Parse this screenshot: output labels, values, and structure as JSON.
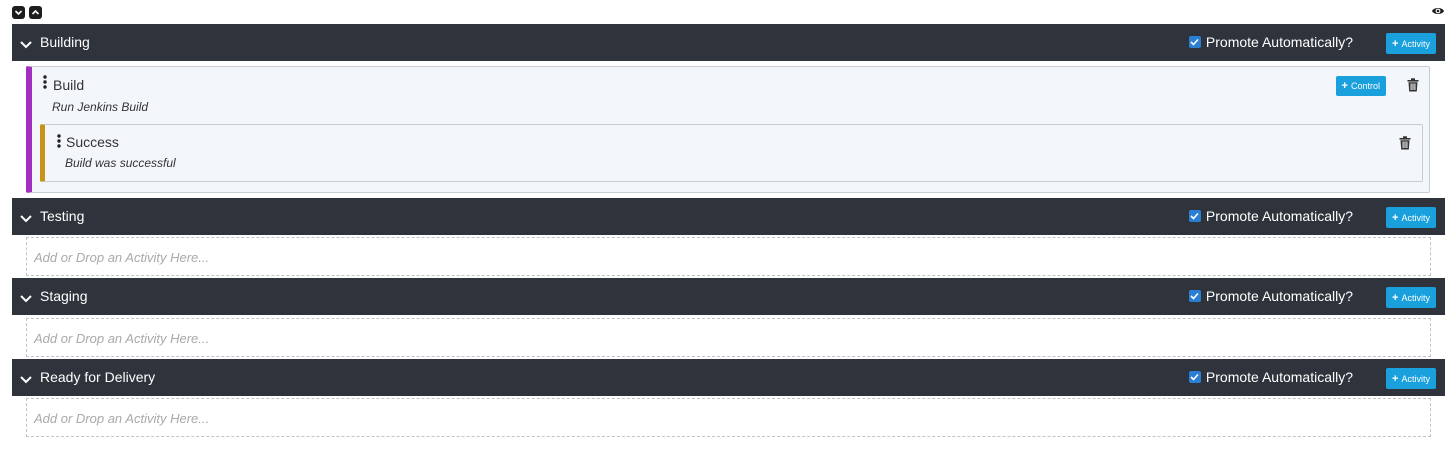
{
  "toolbar": {
    "collapse_all_icon": "chevron-down-square-icon",
    "expand_all_icon": "chevron-up-square-icon",
    "view_icon": "eye-icon"
  },
  "colors": {
    "header_bg": "#2f333b",
    "accent_button": "#1aa0dd",
    "activity_bar": "#a12fbf",
    "control_bar": "#c99416",
    "checkbox": "#2a7fd4"
  },
  "stages": [
    {
      "title": "Building",
      "promote_label": "Promote Automatically?",
      "promote_checked": true,
      "add_label": "Activity",
      "activity": {
        "name": "Build",
        "description": "Run Jenkins Build",
        "control_button_label": "Control",
        "control": {
          "name": "Success",
          "description": "Build was successful"
        }
      }
    },
    {
      "title": "Testing",
      "promote_label": "Promote Automatically?",
      "promote_checked": true,
      "add_label": "Activity",
      "drop_placeholder": "Add or Drop an Activity Here..."
    },
    {
      "title": "Staging",
      "promote_label": "Promote Automatically?",
      "promote_checked": true,
      "add_label": "Activity",
      "drop_placeholder": "Add or Drop an Activity Here..."
    },
    {
      "title": "Ready for Delivery",
      "promote_label": "Promote Automatically?",
      "promote_checked": true,
      "add_label": "Activity",
      "drop_placeholder": "Add or Drop an Activity Here..."
    }
  ]
}
